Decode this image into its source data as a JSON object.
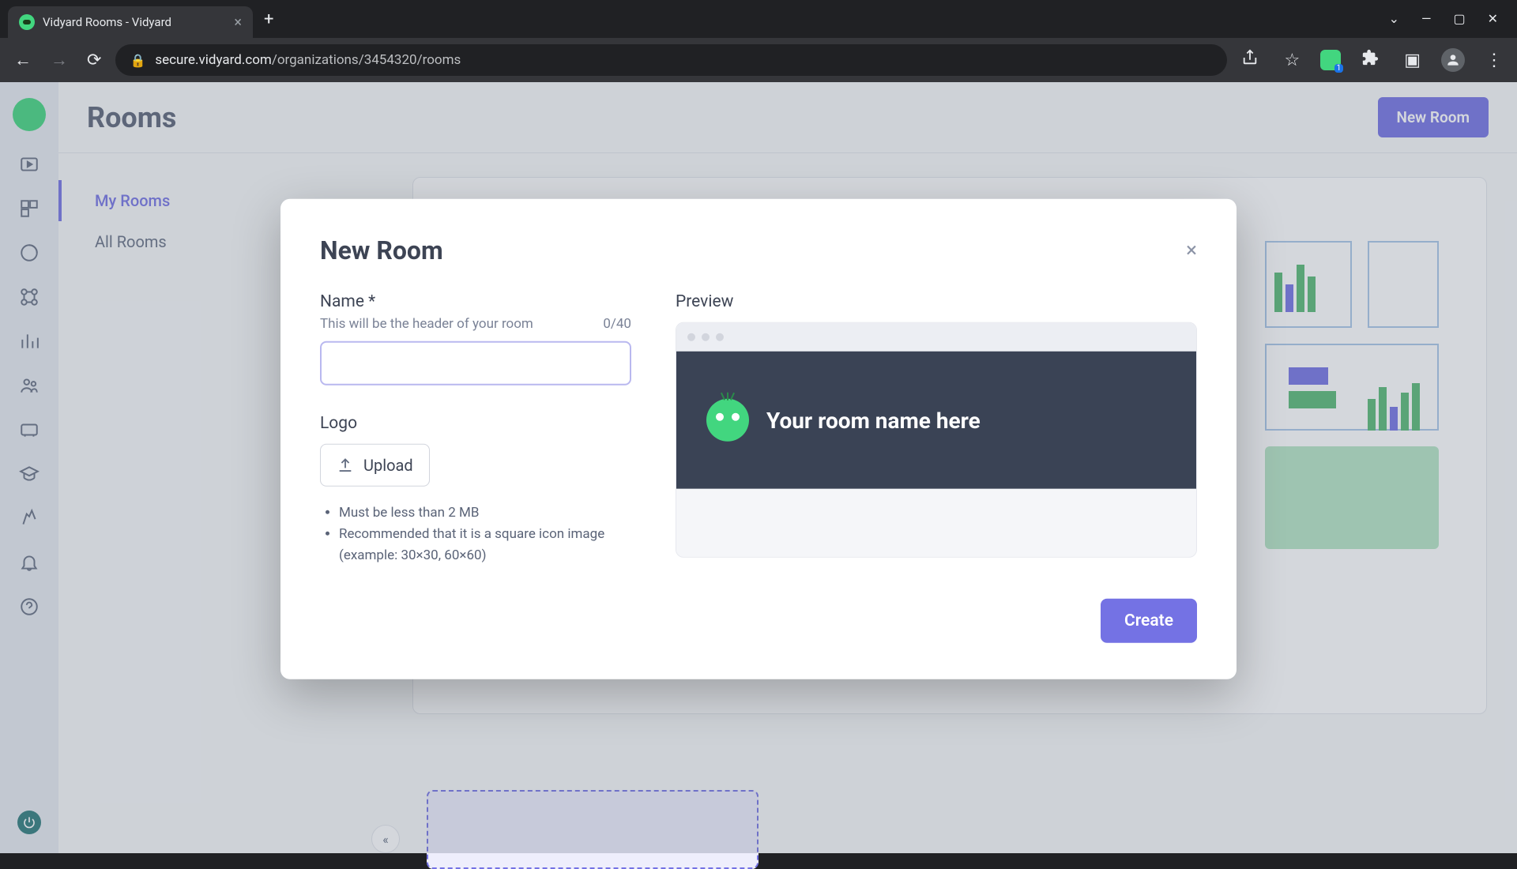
{
  "browser": {
    "tab_title": "Vidyard Rooms - Vidyard",
    "url_domain": "secure.vidyard.com",
    "url_path": "/organizations/3454320/rooms",
    "extension_badge": "1"
  },
  "page": {
    "title": "Rooms",
    "new_room_button": "New Room"
  },
  "subnav": {
    "my_rooms": "My Rooms",
    "all_rooms": "All Rooms"
  },
  "modal": {
    "title": "New Room",
    "name_label": "Name *",
    "name_hint": "This will be the header of your room",
    "name_counter": "0/40",
    "logo_label": "Logo",
    "upload_label": "Upload",
    "req1": "Must be less than 2 MB",
    "req2": "Recommended that it is a square icon image (example: 30×30, 60×60)",
    "preview_label": "Preview",
    "preview_placeholder": "Your room name here",
    "create_button": "Create"
  }
}
